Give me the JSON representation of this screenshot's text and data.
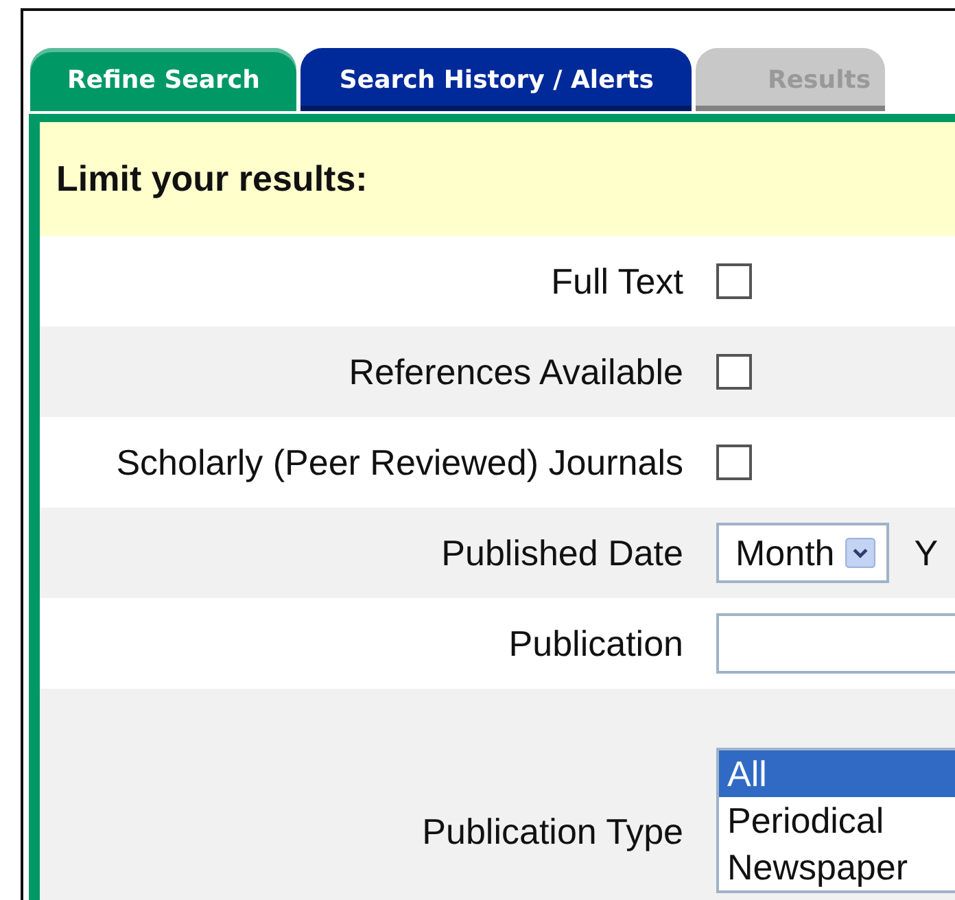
{
  "tabs": [
    {
      "label": "Refine Search",
      "selected": true,
      "color": "#009966"
    },
    {
      "label": "Search History / Alerts",
      "selected": false,
      "color": "#002a99"
    },
    {
      "label": "Results",
      "selected": false,
      "color": "#c8c8c8"
    }
  ],
  "heading": "Limit your results:",
  "rows": [
    {
      "kind": "checkbox",
      "label": "Full Text",
      "checked": false
    },
    {
      "kind": "checkbox",
      "label": "References Available",
      "checked": false
    },
    {
      "kind": "checkbox",
      "label": "Scholarly (Peer Reviewed) Journals",
      "checked": false
    },
    {
      "kind": "date",
      "label": "Published Date",
      "value": "Month",
      "after": "Y"
    },
    {
      "kind": "text",
      "label": "Publication"
    },
    {
      "kind": "list",
      "label": "Publication Type",
      "options": [
        {
          "label": "All",
          "selected": true
        },
        {
          "label": "Periodical",
          "selected": false
        },
        {
          "label": "Newspaper",
          "selected": false
        }
      ]
    }
  ]
}
